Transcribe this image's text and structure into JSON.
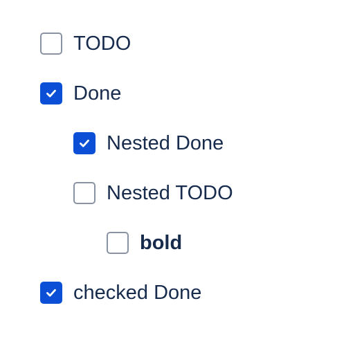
{
  "colors": {
    "checked_fill": "#0b4fd6",
    "unchecked_border": "#8993a4",
    "text": "#172b4d",
    "check_mark": "#ffffff"
  },
  "tasks": [
    {
      "label": "TODO",
      "checked": false,
      "bold": false,
      "depth": 0
    },
    {
      "label": "Done",
      "checked": true,
      "bold": false,
      "depth": 0
    },
    {
      "label": "Nested Done",
      "checked": true,
      "bold": false,
      "depth": 1
    },
    {
      "label": "Nested TODO",
      "checked": false,
      "bold": false,
      "depth": 1
    },
    {
      "label": "bold",
      "checked": false,
      "bold": true,
      "depth": 2
    },
    {
      "label": "checked Done",
      "checked": true,
      "bold": false,
      "depth": 0
    }
  ],
  "icons": {
    "checked": "checkmark-icon",
    "unchecked": "empty-checkbox-icon"
  }
}
